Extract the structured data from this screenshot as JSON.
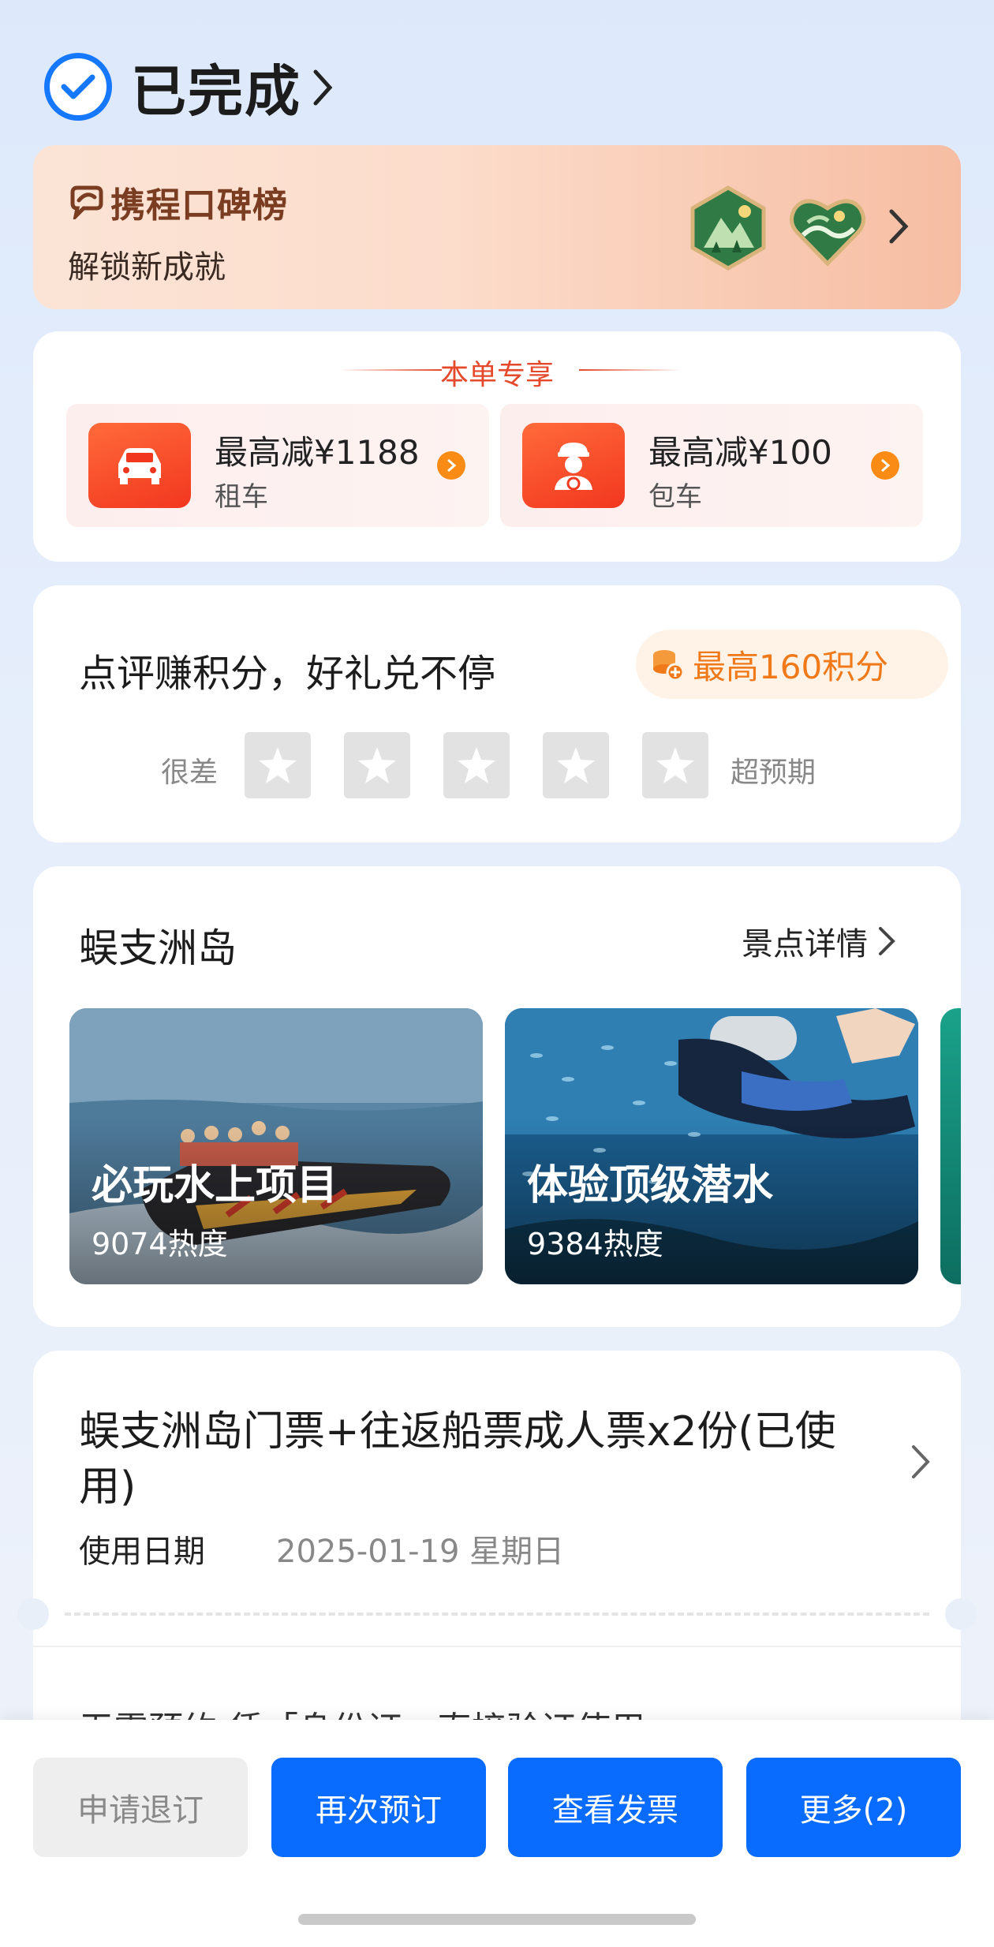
{
  "header": {
    "status": "已完成"
  },
  "rank_banner": {
    "logo_text": "携程口碑榜",
    "subtitle": "解锁新成就"
  },
  "exclusive": {
    "title": "本单专享",
    "items": [
      {
        "main": "最高减¥1188",
        "sub": "租车",
        "icon": "car-icon"
      },
      {
        "main": "最高减¥100",
        "sub": "包车",
        "icon": "chauffeur-icon"
      }
    ]
  },
  "review": {
    "title": "点评赚积分，好礼兑不停",
    "points": "最高160积分",
    "low_label": "很差",
    "high_label": "超预期",
    "star_count": 5
  },
  "island": {
    "title": "蜈支洲岛",
    "detail_link": "景点详情",
    "tiles": [
      {
        "title": "必玩水上项目",
        "heat": "9074热度"
      },
      {
        "title": "体验顶级潜水",
        "heat": "9384热度"
      }
    ]
  },
  "ticket": {
    "title": "蜈支洲岛门票+往返船票成人票x2份(已使用)",
    "date_label": "使用日期",
    "date_value": "2025-01-19 星期日",
    "note": "无需预约·凭「身份证」直接验证使用"
  },
  "actions": {
    "refund": "申请退订",
    "rebook": "再次预订",
    "invoice": "查看发票",
    "more": "更多(2)"
  },
  "colors": {
    "accent": "#0a6bff",
    "check": "#1677ff",
    "promo": "#e5492b",
    "points": "#f07a1a"
  }
}
